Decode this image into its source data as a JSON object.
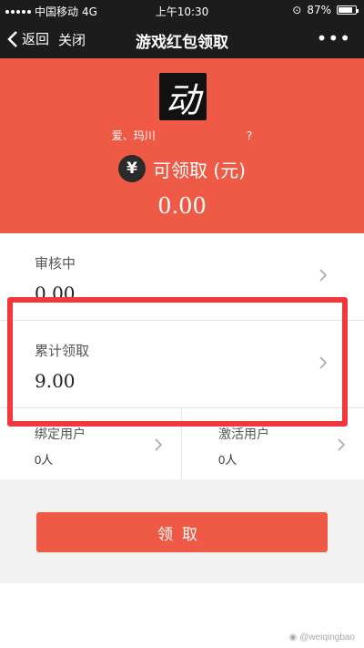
{
  "status_bar": {
    "carrier": "中国移动",
    "network": "4G",
    "time": "上午10:30",
    "battery": "87%",
    "battery_level": 0.87
  },
  "navbar": {
    "back_label": "返回",
    "close_label": "关闭",
    "title": "游戏红包领取",
    "more_label": "•••"
  },
  "hero": {
    "logo_text": "动",
    "game_name": "爱、玛川",
    "game_name_suffix": "?",
    "yen_symbol": "¥",
    "claimable_label": "可领取 (元)",
    "claimable_value": "0.00"
  },
  "cards": {
    "review": {
      "label": "审核中",
      "value": "0.00"
    },
    "total": {
      "label": "累计领取",
      "value": "9.00"
    },
    "bound": {
      "label": "绑定用户",
      "value": "0人"
    },
    "activated": {
      "label": "激活用户",
      "value": "0人"
    }
  },
  "action": {
    "claim_button": "领取"
  },
  "watermark": {
    "text": "@weiqingbao"
  },
  "colors": {
    "brand_red": "#ee5a45",
    "highlight_red": "#f0383d",
    "dark_bar": "#1c1c1c"
  }
}
